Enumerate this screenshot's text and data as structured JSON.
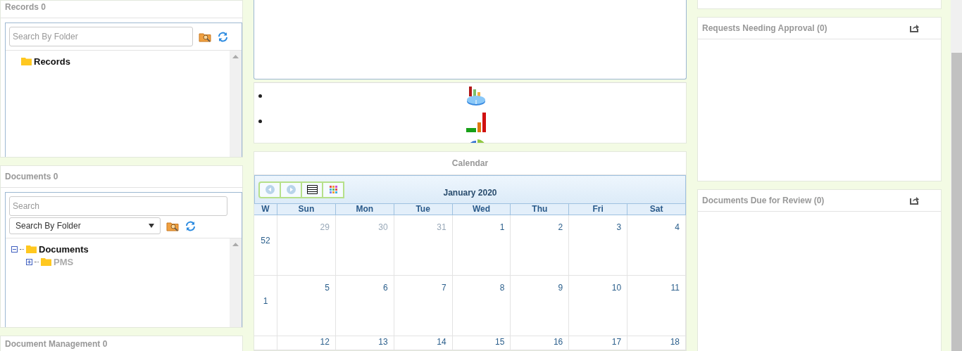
{
  "left": {
    "records": {
      "title": "Records 0",
      "search": {
        "placeholder": "Search By Folder"
      },
      "tree": [
        {
          "label": "Records",
          "disabled": false
        }
      ]
    },
    "documents": {
      "title": "Documents 0",
      "search": {
        "placeholder": "Search"
      },
      "folder_select": {
        "value": "Search By Folder"
      },
      "tree": [
        {
          "label": "Documents",
          "expanded": true,
          "disabled": false,
          "children": [
            {
              "label": "PMS",
              "expanded": false,
              "disabled": true
            }
          ]
        }
      ]
    },
    "document_management": {
      "title": "Document Management 0"
    }
  },
  "middle": {
    "chart_links": [
      {
        "kind": "bars-pie"
      },
      {
        "kind": "bars"
      },
      {
        "kind": "pie"
      }
    ],
    "calendar": {
      "title": "Calendar",
      "month": "January 2020",
      "week_header": "W",
      "days": [
        "Sun",
        "Mon",
        "Tue",
        "Wed",
        "Thu",
        "Fri",
        "Sat"
      ],
      "weeks": [
        {
          "week": "52",
          "dates": [
            {
              "label": "29",
              "other_month": true
            },
            {
              "label": "30",
              "other_month": true
            },
            {
              "label": "31",
              "other_month": true
            },
            {
              "label": "1",
              "other_month": false
            },
            {
              "label": "2",
              "other_month": false
            },
            {
              "label": "3",
              "other_month": false
            },
            {
              "label": "4",
              "other_month": false
            }
          ]
        },
        {
          "week": "1",
          "dates": [
            {
              "label": "5",
              "other_month": false
            },
            {
              "label": "6",
              "other_month": false
            },
            {
              "label": "7",
              "other_month": false
            },
            {
              "label": "8",
              "other_month": false
            },
            {
              "label": "9",
              "other_month": false
            },
            {
              "label": "10",
              "other_month": false
            },
            {
              "label": "11",
              "other_month": false
            }
          ]
        },
        {
          "dates": [
            {
              "label": "12",
              "other_month": false
            },
            {
              "label": "13",
              "other_month": false
            },
            {
              "label": "14",
              "other_month": false
            },
            {
              "label": "15",
              "other_month": false
            },
            {
              "label": "16",
              "other_month": false
            },
            {
              "label": "17",
              "other_month": false
            },
            {
              "label": "18",
              "other_month": false
            }
          ]
        }
      ]
    }
  },
  "right": {
    "panels": [
      {
        "title": "Requests Needing Approval (0)"
      },
      {
        "title": "Documents Due for Review (0)"
      }
    ]
  }
}
